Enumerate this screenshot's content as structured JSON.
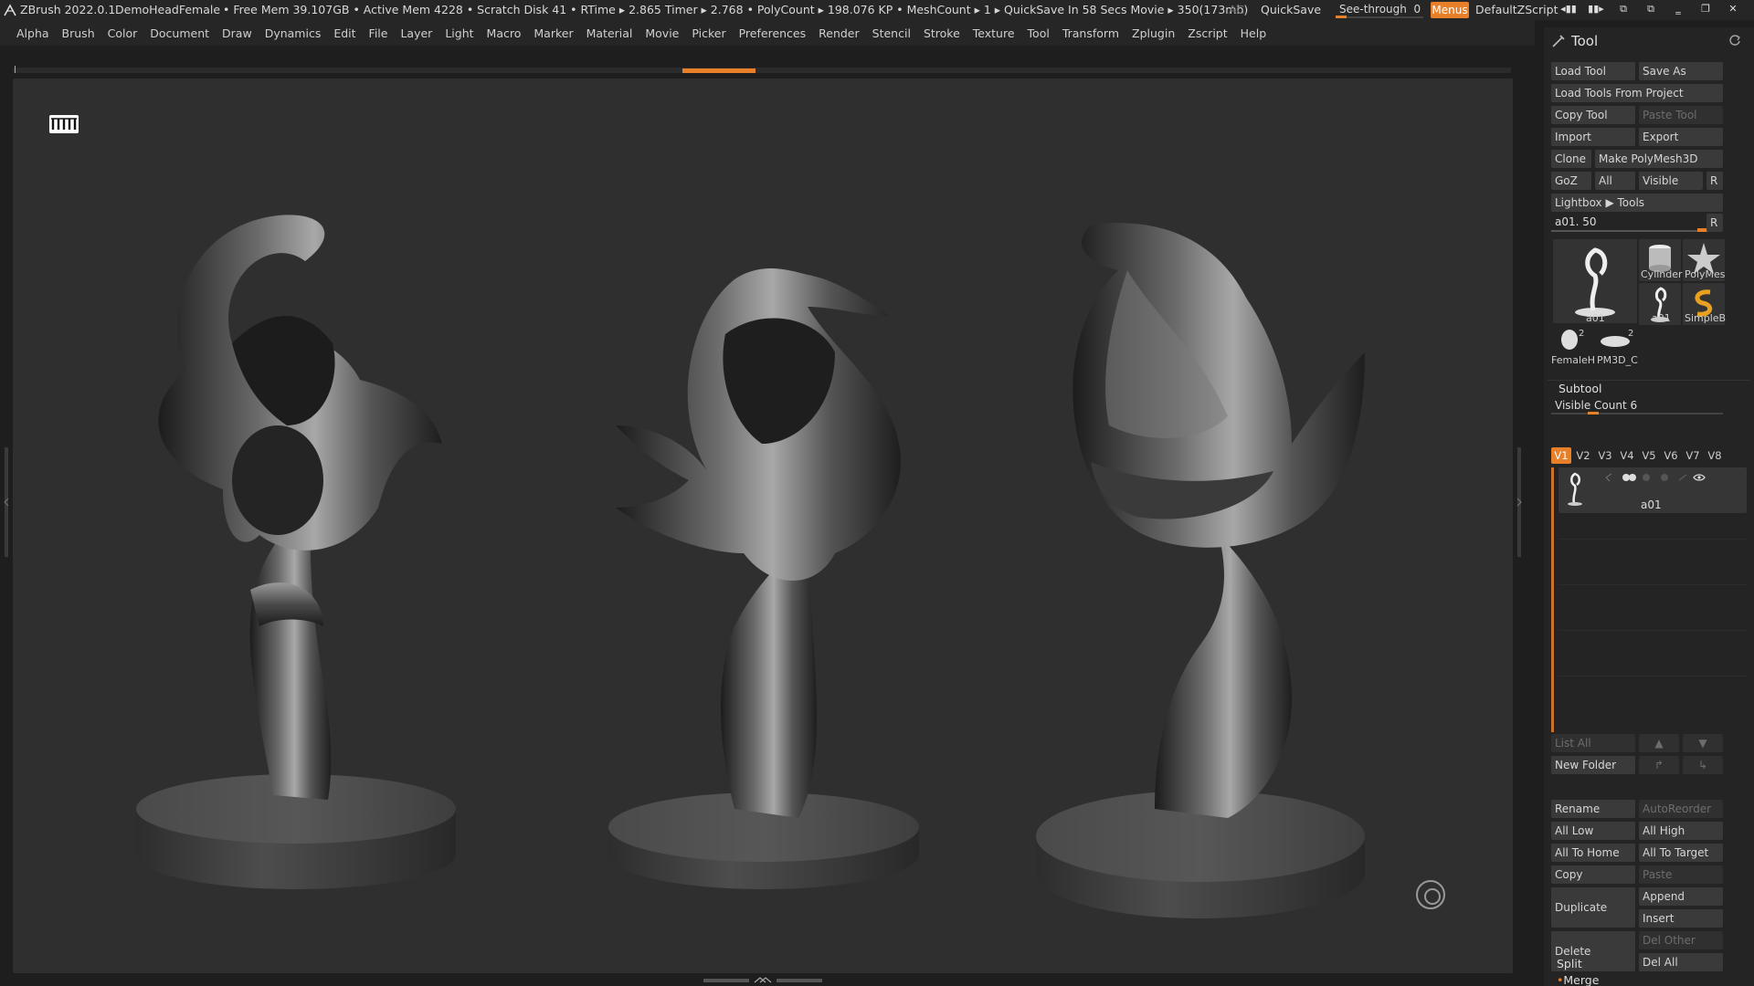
{
  "titlebar": {
    "app": "ZBrush 2022.0.1",
    "project": "DemoHeadFemale",
    "status": "• Free Mem 39.107GB • Active Mem 4228 • Scratch Disk 41 • RTime ▸ 2.865 Timer ▸ 2.768 • PolyCount ▸ 198.076 KP • MeshCount ▸ 1 ▸ QuickSave In 58 Secs Movie ▸ 350(173mb)",
    "ac": "AC",
    "quicksave": "QuickSave",
    "seethrough_label": "See-through",
    "seethrough_value": "0",
    "menus": "Menus",
    "default_zscript": "DefaultZScript"
  },
  "menubar": [
    "Alpha",
    "Brush",
    "Color",
    "Document",
    "Draw",
    "Dynamics",
    "Edit",
    "File",
    "Layer",
    "Light",
    "Macro",
    "Marker",
    "Material",
    "Movie",
    "Picker",
    "Preferences",
    "Render",
    "Stencil",
    "Stroke",
    "Texture",
    "Tool",
    "Transform",
    "Zplugin",
    "Zscript",
    "Help"
  ],
  "tool_panel": {
    "title": "Tool",
    "buttons": {
      "load_tool": "Load Tool",
      "save_as": "Save As",
      "load_tools_from_project": "Load Tools From Project",
      "copy_tool": "Copy Tool",
      "paste_tool": "Paste Tool",
      "import": "Import",
      "export": "Export",
      "clone": "Clone",
      "make_polymesh": "Make PolyMesh3D",
      "goz": "GoZ",
      "all": "All",
      "visible": "Visible",
      "r": "R",
      "lightbox_tools": "Lightbox ▶ Tools"
    },
    "slider": {
      "label": "a01.",
      "value": "50",
      "r": "R"
    },
    "thumbnails": {
      "main": "a01",
      "cylinder": "Cylinder",
      "polymesh": "PolyMes",
      "a01_small": "a01",
      "simpleb": "SimpleB",
      "female": "FemaleH",
      "female_count": "2",
      "pm3d": "PM3D_C",
      "pm3d_count": "2"
    }
  },
  "subtool": {
    "title": "Subtool",
    "visible_count_label": "Visible Count",
    "visible_count_value": "6",
    "tabs": [
      "V1",
      "V2",
      "V3",
      "V4",
      "V5",
      "V6",
      "V7",
      "V8"
    ],
    "active_tab": "V1",
    "items": [
      {
        "name": "a01"
      }
    ],
    "buttons": {
      "list_all": "List All",
      "new_folder": "New Folder",
      "rename": "Rename",
      "autoreorder": "AutoReorder",
      "all_low": "All Low",
      "all_high": "All High",
      "all_to_home": "All To Home",
      "all_to_target": "All To Target",
      "copy": "Copy",
      "paste": "Paste",
      "duplicate": "Duplicate",
      "append": "Append",
      "insert": "Insert",
      "delete": "Delete",
      "del_other": "Del Other",
      "del_all": "Del All",
      "split": "Split",
      "merge": "Merge"
    }
  },
  "colors": {
    "accent": "#e8802a",
    "canvas": "#2f2f2f",
    "panel": "#242424",
    "button": "#3a3a3a"
  }
}
